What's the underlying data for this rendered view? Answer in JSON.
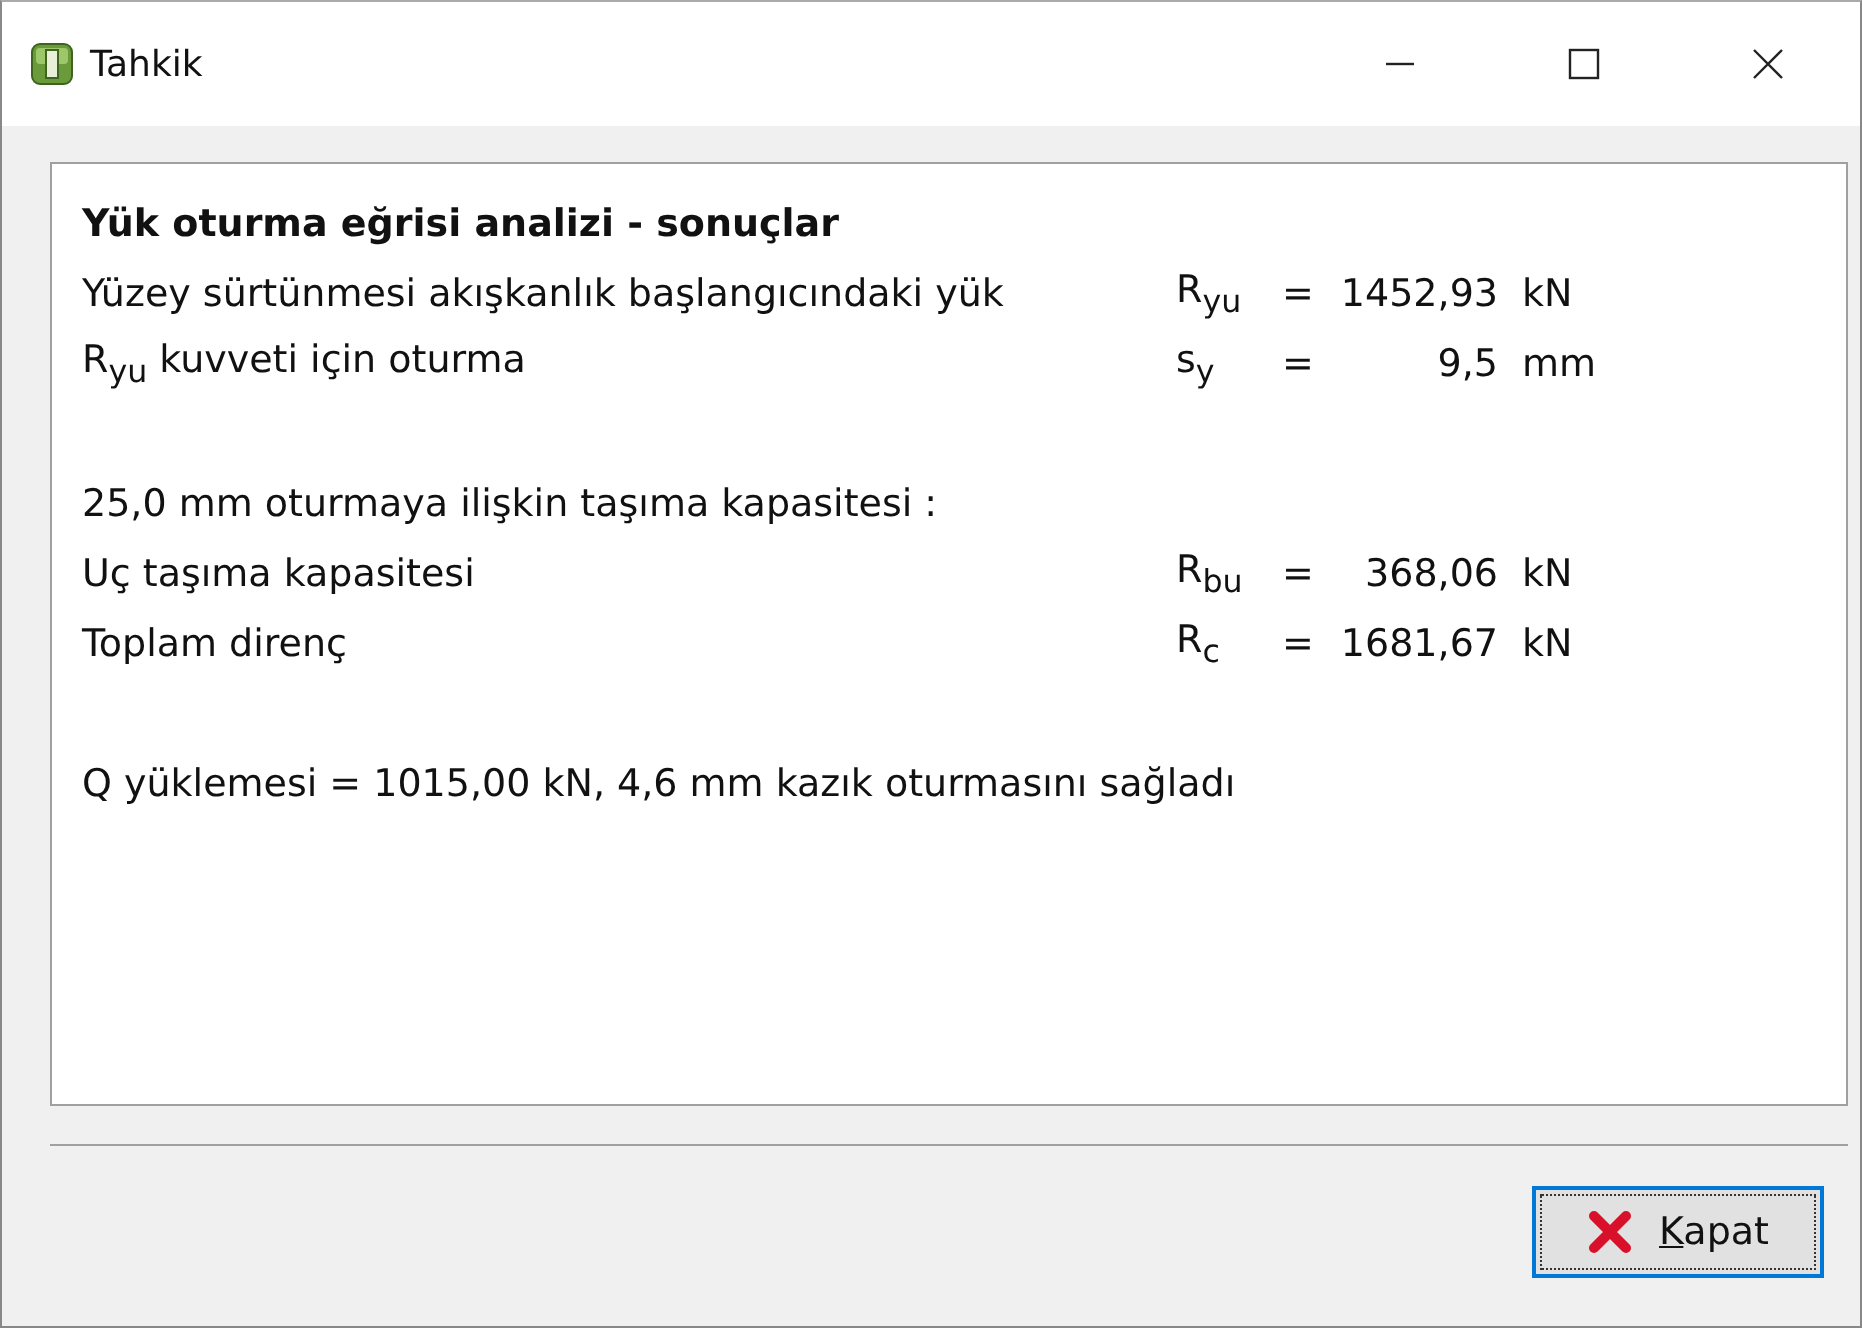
{
  "window": {
    "title": "Tahkik"
  },
  "results": [
    {
      "kind": "heading",
      "text": "Yük oturma eğrisi analizi - sonuçlar"
    },
    {
      "kind": "result",
      "label": "Yüzey sürtünmesi akışkanlık başlangıcındaki yük",
      "symbol": "R$_{yu}$",
      "equals": "=",
      "value": "1452,93",
      "unit": "kN"
    },
    {
      "kind": "result",
      "label": "R$_{yu}$ kuvveti için oturma",
      "symbol": "s$_{y}$",
      "equals": "=",
      "value": "9,5",
      "unit": "mm"
    },
    {
      "kind": "blank"
    },
    {
      "kind": "text",
      "text": "25,0 mm oturmaya ilişkin taşıma kapasitesi :"
    },
    {
      "kind": "result",
      "label": "Uç taşıma kapasitesi",
      "symbol": "R$_{bu}$",
      "equals": "=",
      "value": "368,06",
      "unit": "kN"
    },
    {
      "kind": "result",
      "label": "Toplam direnç",
      "symbol": "R$_{c}$",
      "equals": "=",
      "value": "1681,67",
      "unit": "kN"
    },
    {
      "kind": "blank"
    },
    {
      "kind": "text",
      "text": "Q yüklemesi = 1015,00 kN, 4,6 mm kazık oturmasını sağladı"
    }
  ],
  "close_button": {
    "label": "Kapat",
    "mnemonic_underlined": true
  }
}
